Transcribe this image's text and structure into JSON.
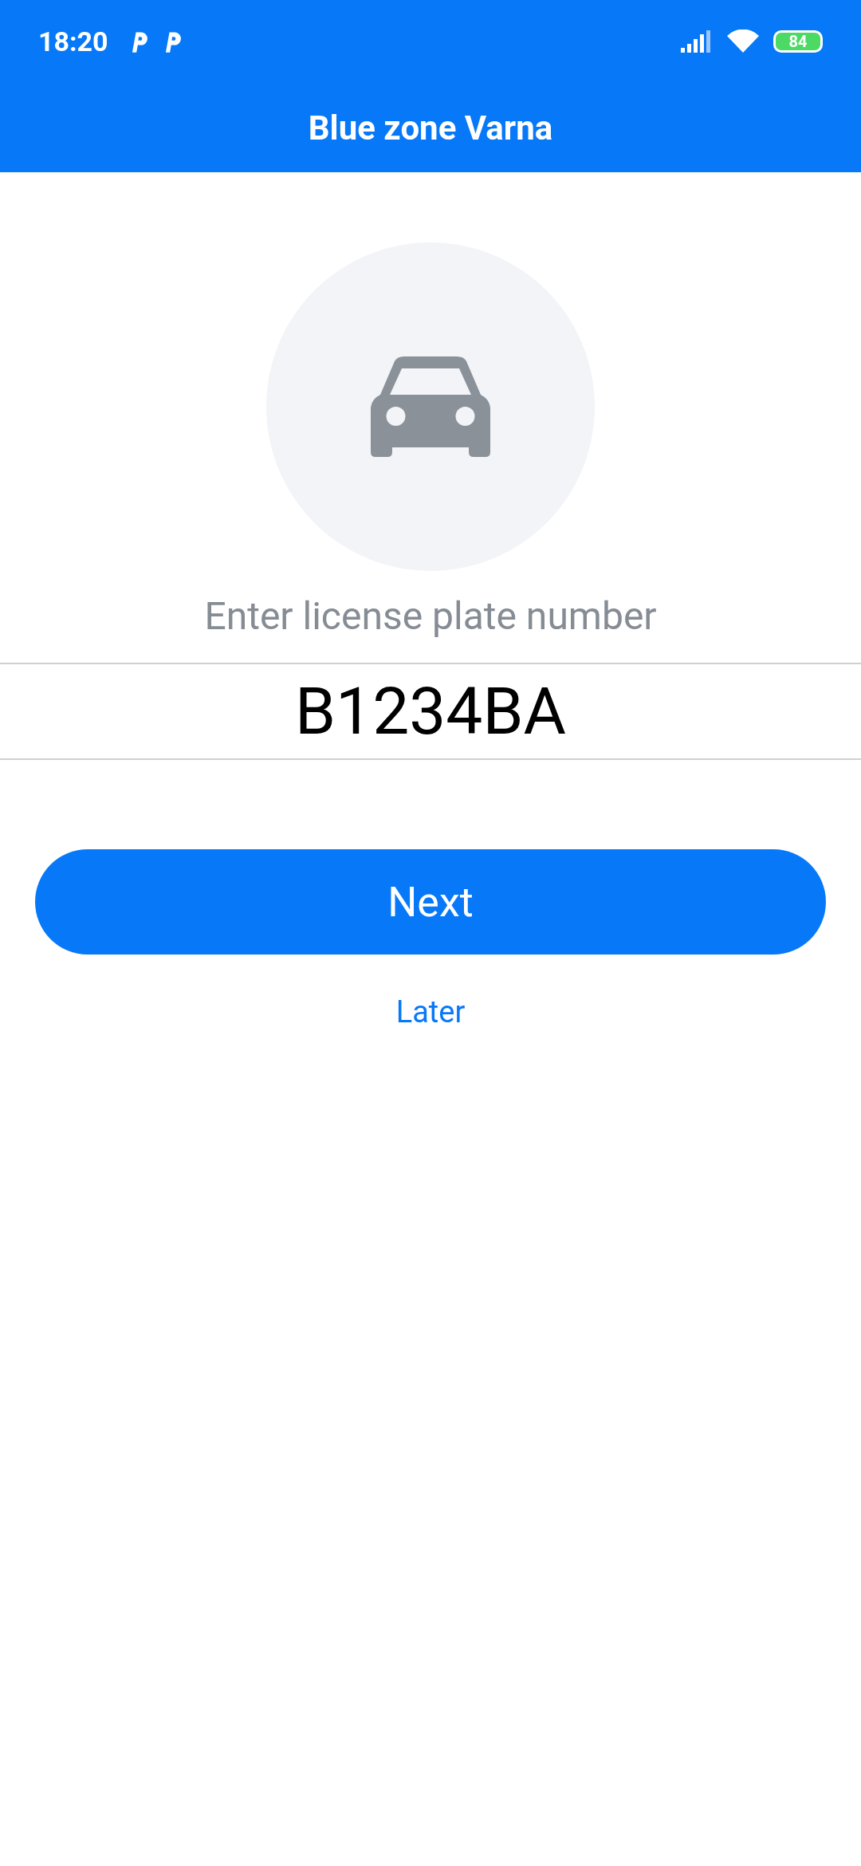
{
  "status_bar": {
    "time": "18:20",
    "battery": "84"
  },
  "app_bar": {
    "title": "Blue zone Varna"
  },
  "prompt": "Enter license plate number",
  "plate_field": {
    "value": "B1234BA"
  },
  "buttons": [
    {
      "kind": "primary",
      "label": "Next"
    },
    {
      "kind": "link",
      "label": "Later"
    }
  ]
}
